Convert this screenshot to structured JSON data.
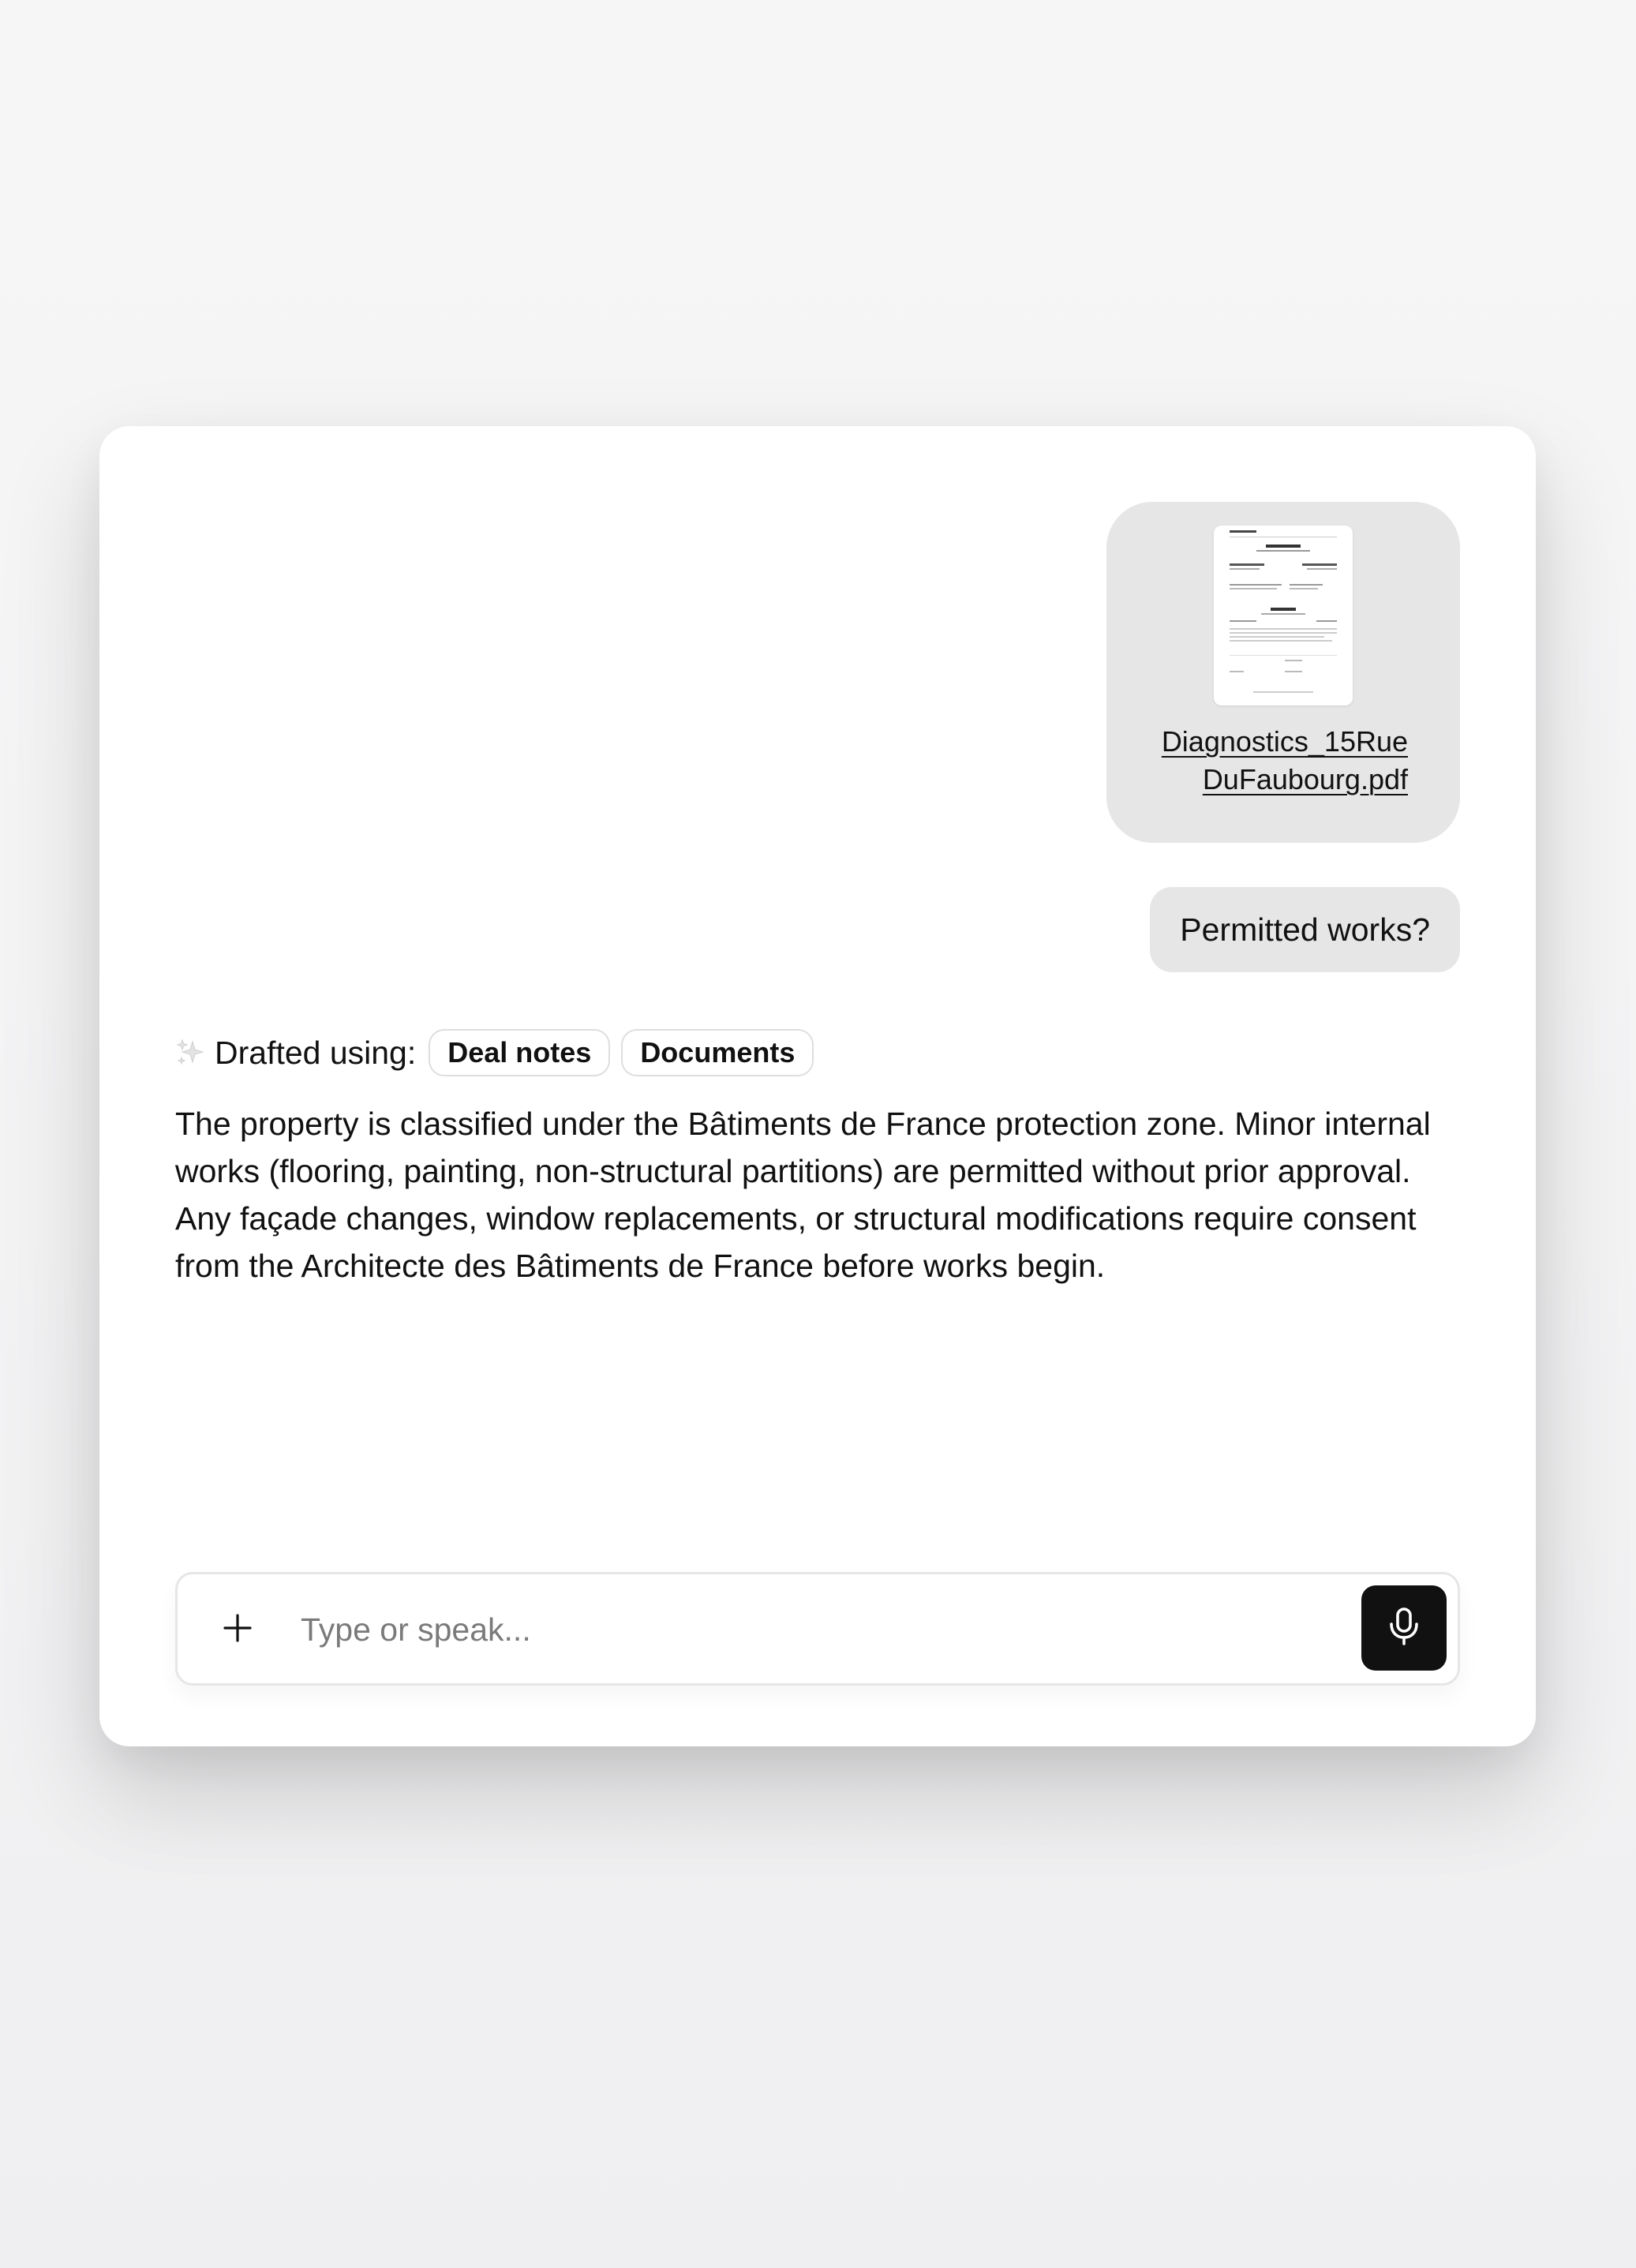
{
  "attachment": {
    "file_name": "Diagnostics_15Rue\nDuFaubourg.pdf",
    "icon": "pdf-document-thumbnail"
  },
  "user_message": {
    "text": "Permitted works?"
  },
  "assistant": {
    "drafted_label": "Drafted using:",
    "sources": [
      "Deal notes",
      "Documents"
    ],
    "answer": "The property is classified under the Bâtiments de France protection zone. Minor internal works (flooring, painting, non-structural partitions) are permitted without prior approval. Any façade changes, window replacements, or structural modifications require consent from the Architecte des Bâtiments de France before works begin."
  },
  "composer": {
    "placeholder": "Type or speak...",
    "value": "",
    "add_icon": "plus-icon",
    "mic_icon": "microphone-icon"
  },
  "colors": {
    "bubble": "#e6e6e6",
    "text": "#111111",
    "mic_bg": "#111111",
    "chip_border": "#dedede",
    "placeholder": "#7a7a7a"
  }
}
